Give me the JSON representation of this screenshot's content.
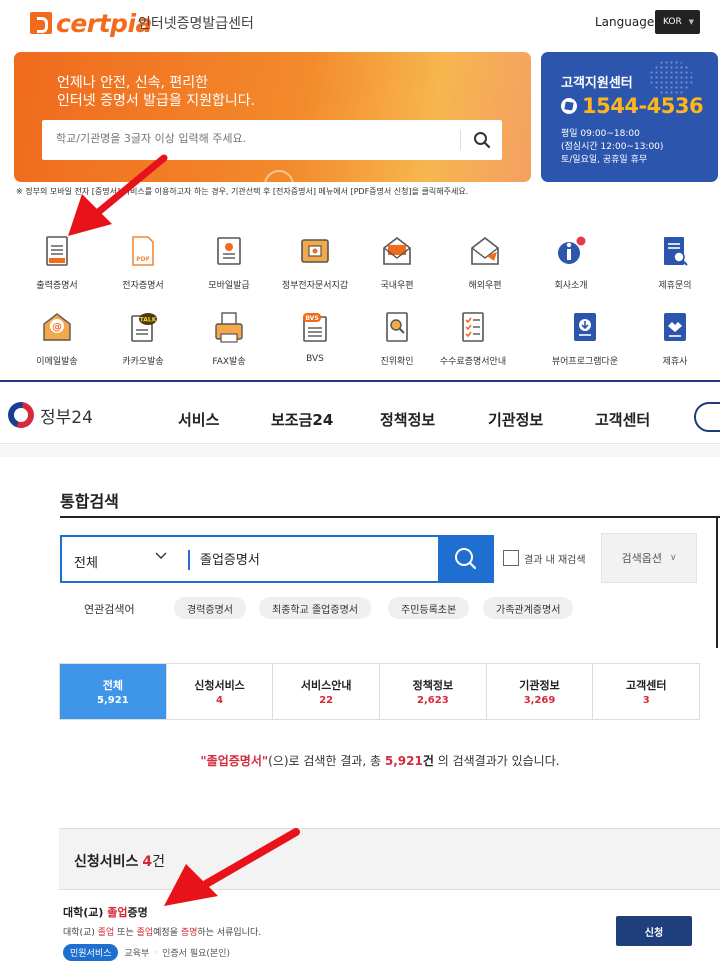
{
  "certpia": {
    "logo_text": "certpia",
    "tagline": "인터넷증명발급센터",
    "language_label": "Language",
    "language_value": "KOR",
    "banner": {
      "line1": "언제나 안전, 신속, 편리한",
      "line2": "인터넷 증명서 발급을 지원합니다.",
      "search_placeholder": "학교/기관명을 3글자 이상 입력해 주세요."
    },
    "support": {
      "title": "고객지원센터",
      "phone": "1544-4536",
      "hours1": "평일 09:00~18:00",
      "hours2": "(점심시간 12:00~13:00)",
      "hours3": "토/일요일, 공휴일 휴무"
    },
    "notice": "※ 정부의 모바일 전자 [증명서] 서비스를 이용하고자 하는 경우, 기관선택 후 [전자증명서] 메뉴에서 [PDF증명서 신청]을 클릭해주세요.",
    "services": [
      {
        "label": "출력증명서",
        "icon": "printed-certificate-icon"
      },
      {
        "label": "전자증명서",
        "icon": "pdf-certificate-icon"
      },
      {
        "label": "모바일발급",
        "icon": "mobile-issue-icon"
      },
      {
        "label": "정부전자문서지갑",
        "icon": "gov-document-wallet-icon"
      },
      {
        "label": "국내우편",
        "icon": "domestic-mail-icon"
      },
      {
        "label": "해외우편",
        "icon": "overseas-mail-icon"
      },
      {
        "label": "회사소개",
        "icon": "company-info-icon"
      },
      {
        "label": "제휴문의",
        "icon": "partnership-inquiry-icon"
      },
      {
        "label": "이메일발송",
        "icon": "email-send-icon"
      },
      {
        "label": "카카오발송",
        "icon": "kakao-send-icon"
      },
      {
        "label": "FAX발송",
        "icon": "fax-send-icon"
      },
      {
        "label": "BVS",
        "icon": "bvs-icon"
      },
      {
        "label": "진위확인",
        "icon": "authenticity-check-icon"
      },
      {
        "label": "수수료증명서안내",
        "icon": "fee-certificate-guide-icon"
      },
      {
        "label": "뷰어프로그램다운",
        "icon": "viewer-download-icon"
      },
      {
        "label": "제휴사",
        "icon": "partner-companies-icon"
      }
    ]
  },
  "gov24": {
    "logo_text": "정부24",
    "menu": [
      "서비스",
      "보조금24",
      "정책정보",
      "기관정보",
      "고객센터"
    ],
    "page_title": "통합검색",
    "search": {
      "scope": "전체",
      "query": "졸업증명서",
      "recheck_label": "결과 내 재검색",
      "options_label": "검색옵션"
    },
    "related_label": "연관검색어",
    "related": [
      "경력증명서",
      "최종학교 졸업증명서",
      "주민등록초본",
      "가족관계증명서"
    ],
    "tabs": [
      {
        "label": "전체",
        "count": "5,921"
      },
      {
        "label": "신청서비스",
        "count": "4"
      },
      {
        "label": "서비스안내",
        "count": "22"
      },
      {
        "label": "정책정보",
        "count": "2,623"
      },
      {
        "label": "기관정보",
        "count": "3,269"
      },
      {
        "label": "고객센터",
        "count": "3"
      }
    ],
    "result": {
      "query_quoted": "\"졸업증명서\"",
      "mid": "(으)로 검색한 결과, 총 ",
      "total": "5,921",
      "unit": "건",
      "tail": " 의 검색결과가 있습니다."
    },
    "section": {
      "title": "신청서비스",
      "count": "4",
      "unit": "건"
    },
    "item": {
      "title_pre": "대학(교) ",
      "title_hl": "졸업",
      "title_post": "증명",
      "desc_a": "대학(교) ",
      "desc_hl1": "졸업",
      "desc_b": " 또는 ",
      "desc_hl2": "졸업",
      "desc_c": "예정을 ",
      "desc_hl3": "증명",
      "desc_d": "하는 서류입니다.",
      "badge": "민원서비스",
      "agency": "교육부",
      "auth": "인증서 필요(본인)",
      "apply_label": "신청"
    }
  },
  "colors": {
    "certpia_orange": "#f26b1d",
    "support_blue": "#2c55ad",
    "phone_yellow": "#ffb51c",
    "gov_blue": "#1f6fd0",
    "active_tab": "#3f96e8",
    "highlight_red": "#d62a3a",
    "annotation_arrow": "#e8121b"
  }
}
